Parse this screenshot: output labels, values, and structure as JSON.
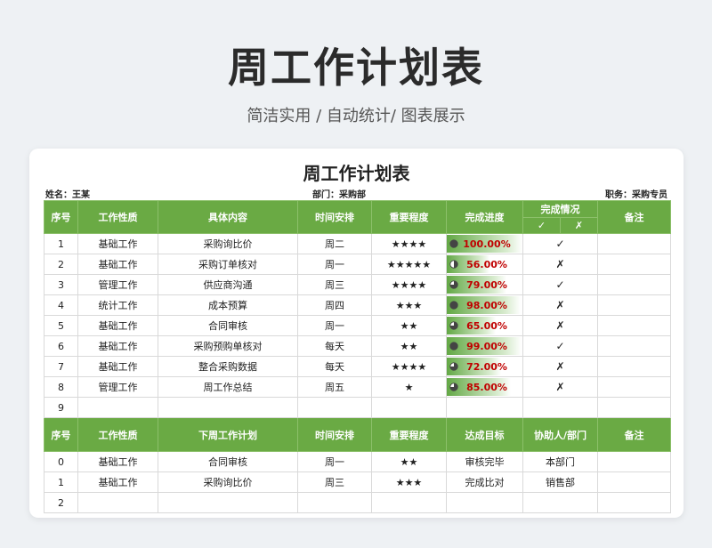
{
  "page": {
    "title": "周工作计划表",
    "subtitle": "简洁实用 / 自动统计/ 图表展示"
  },
  "sheet": {
    "title": "周工作计划表",
    "name_label": "姓名：王某",
    "dept_label": "部门：采购部",
    "role_label": "职务：采购专员"
  },
  "table1": {
    "headers": {
      "index": "序号",
      "type": "工作性质",
      "content": "具体内容",
      "schedule": "时间安排",
      "importance": "重要程度",
      "progress": "完成进度",
      "status": "完成情况",
      "status_done": "✓",
      "status_not": "✗",
      "notes": "备注"
    },
    "rows": [
      {
        "index": "1",
        "type": "基础工作",
        "content": "采购询比价",
        "schedule": "周二",
        "stars": "★★★★",
        "progress_value": 1.0,
        "progress_text": "100.00%",
        "mark": "✓"
      },
      {
        "index": "2",
        "type": "基础工作",
        "content": "采购订单核对",
        "schedule": "周一",
        "stars": "★★★★★",
        "progress_value": 0.56,
        "progress_text": "56.00%",
        "mark": "✗"
      },
      {
        "index": "3",
        "type": "管理工作",
        "content": "供应商沟通",
        "schedule": "周三",
        "stars": "★★★★",
        "progress_value": 0.79,
        "progress_text": "79.00%",
        "mark": "✓"
      },
      {
        "index": "4",
        "type": "统计工作",
        "content": "成本预算",
        "schedule": "周四",
        "stars": "★★★",
        "progress_value": 0.98,
        "progress_text": "98.00%",
        "mark": "✗"
      },
      {
        "index": "5",
        "type": "基础工作",
        "content": "合同审核",
        "schedule": "周一",
        "stars": "★★",
        "progress_value": 0.65,
        "progress_text": "65.00%",
        "mark": "✗"
      },
      {
        "index": "6",
        "type": "基础工作",
        "content": "采购预购单核对",
        "schedule": "每天",
        "stars": "★★",
        "progress_value": 0.99,
        "progress_text": "99.00%",
        "mark": "✓"
      },
      {
        "index": "7",
        "type": "基础工作",
        "content": "整合采购数据",
        "schedule": "每天",
        "stars": "★★★★",
        "progress_value": 0.72,
        "progress_text": "72.00%",
        "mark": "✗"
      },
      {
        "index": "8",
        "type": "管理工作",
        "content": "周工作总结",
        "schedule": "周五",
        "stars": "★",
        "progress_value": 0.85,
        "progress_text": "85.00%",
        "mark": "✗"
      },
      {
        "index": "9",
        "type": "",
        "content": "",
        "schedule": "",
        "stars": "",
        "progress_value": null,
        "progress_text": "",
        "mark": ""
      }
    ]
  },
  "table2": {
    "headers": {
      "index": "序号",
      "type": "工作性质",
      "plan": "下周工作计划",
      "schedule": "时间安排",
      "importance": "重要程度",
      "goal": "达成目标",
      "helper": "协助人/部门",
      "notes": "备注"
    },
    "rows": [
      {
        "index": "0",
        "type": "基础工作",
        "plan": "合同审核",
        "schedule": "周一",
        "stars": "★★",
        "goal": "审核完毕",
        "helper": "本部门"
      },
      {
        "index": "1",
        "type": "基础工作",
        "plan": "采购询比价",
        "schedule": "周三",
        "stars": "★★★",
        "goal": "完成比对",
        "helper": "销售部"
      },
      {
        "index": "2",
        "type": "",
        "plan": "",
        "schedule": "",
        "stars": "",
        "goal": "",
        "helper": ""
      }
    ]
  },
  "colors": {
    "header_green": "#6aaa44",
    "progress_text": "#c00000",
    "stars": "#1f6e73"
  }
}
